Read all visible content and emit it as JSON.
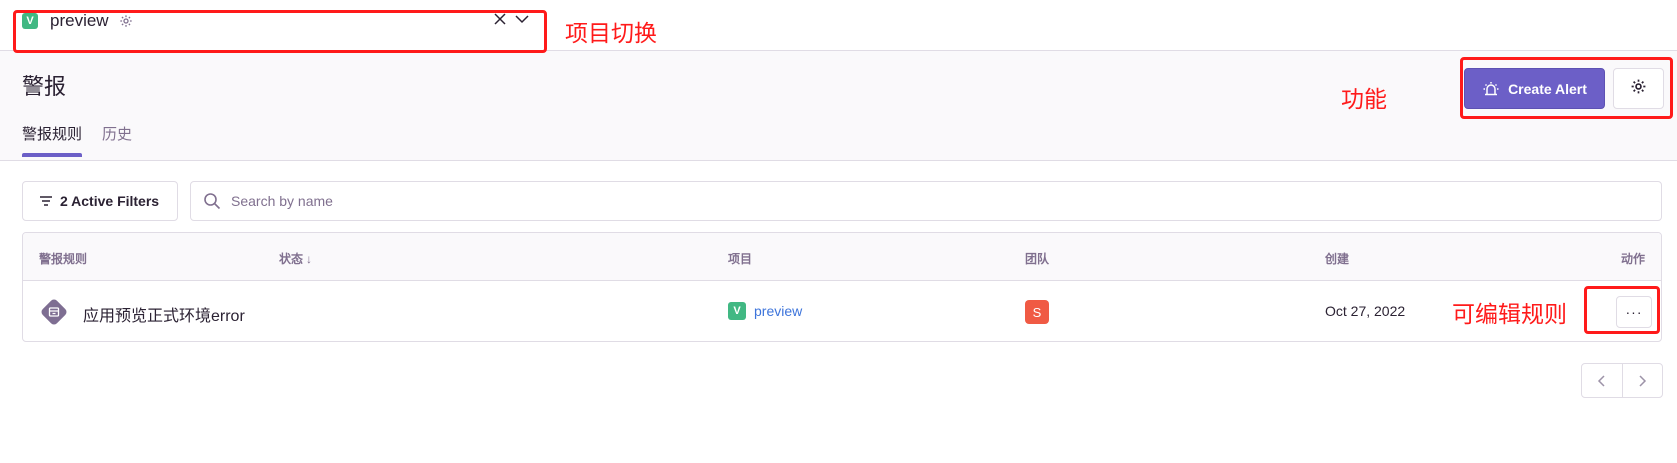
{
  "project_switcher": {
    "project_name": "preview",
    "project_badge": "V",
    "clear_icon": "close-icon",
    "caret_icon": "chevron-down-icon",
    "settings_icon": "gear-icon"
  },
  "header": {
    "title": "警报",
    "tabs": [
      {
        "label": "警报规则",
        "active": true
      },
      {
        "label": "历史",
        "active": false
      }
    ],
    "create_alert_label": "Create Alert",
    "create_alert_icon": "siren-icon",
    "settings_icon": "gear-icon"
  },
  "filters": {
    "active_filters_label": "2 Active Filters",
    "search_placeholder": "Search by name"
  },
  "table": {
    "columns": [
      "警报规则",
      "状态",
      "项目",
      "团队",
      "创建",
      "动作"
    ],
    "sort_indicator": "↓",
    "rows": [
      {
        "rule_name": "应用预览正式环境error",
        "status": "",
        "project": "preview",
        "project_badge": "V",
        "team_initial": "S",
        "created": "Oct 27, 2022",
        "actions_label": "···"
      }
    ]
  },
  "pagination": {
    "prev_icon": "chevron-left-icon",
    "next_icon": "chevron-right-icon"
  },
  "annotations": {
    "project_switch": "项目切换",
    "functions": "功能",
    "editable_rule": "可编辑规则"
  },
  "colors": {
    "accent": "#6c5fc7",
    "annotation": "#ff1a1a",
    "project_badge": "#41b883",
    "team_avatar": "#f05a44",
    "link": "#3d74db"
  }
}
